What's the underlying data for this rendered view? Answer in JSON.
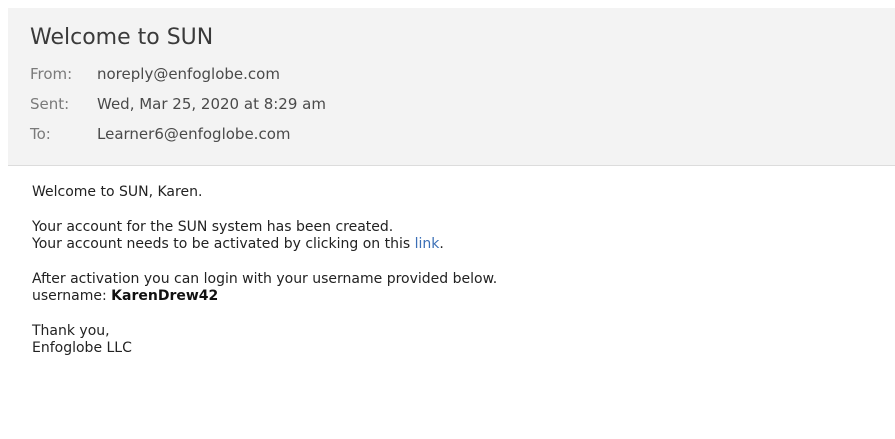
{
  "email": {
    "subject": "Welcome to SUN",
    "from_label": "From:",
    "from_value": "noreply@enfoglobe.com",
    "sent_label": "Sent:",
    "sent_value": "Wed, Mar 25, 2020 at 8:29 am",
    "to_label": "To:",
    "to_value": "Learner6@enfoglobe.com"
  },
  "body": {
    "greeting": "Welcome to SUN, Karen.",
    "line_created": "Your account for the SUN system has been created.",
    "line_activate_prefix": "Your account needs to be activated by clicking on this ",
    "link_text": "link",
    "line_activate_suffix": ".",
    "line_after_activation": "After activation you can login with your username provided below.",
    "username_label": "username: ",
    "username_value": "KarenDrew42",
    "thanks": "Thank you,",
    "signature": "Enfoglobe LLC"
  },
  "colors": {
    "header_bg": "#f3f3f3",
    "link": "#3b6fb6"
  }
}
